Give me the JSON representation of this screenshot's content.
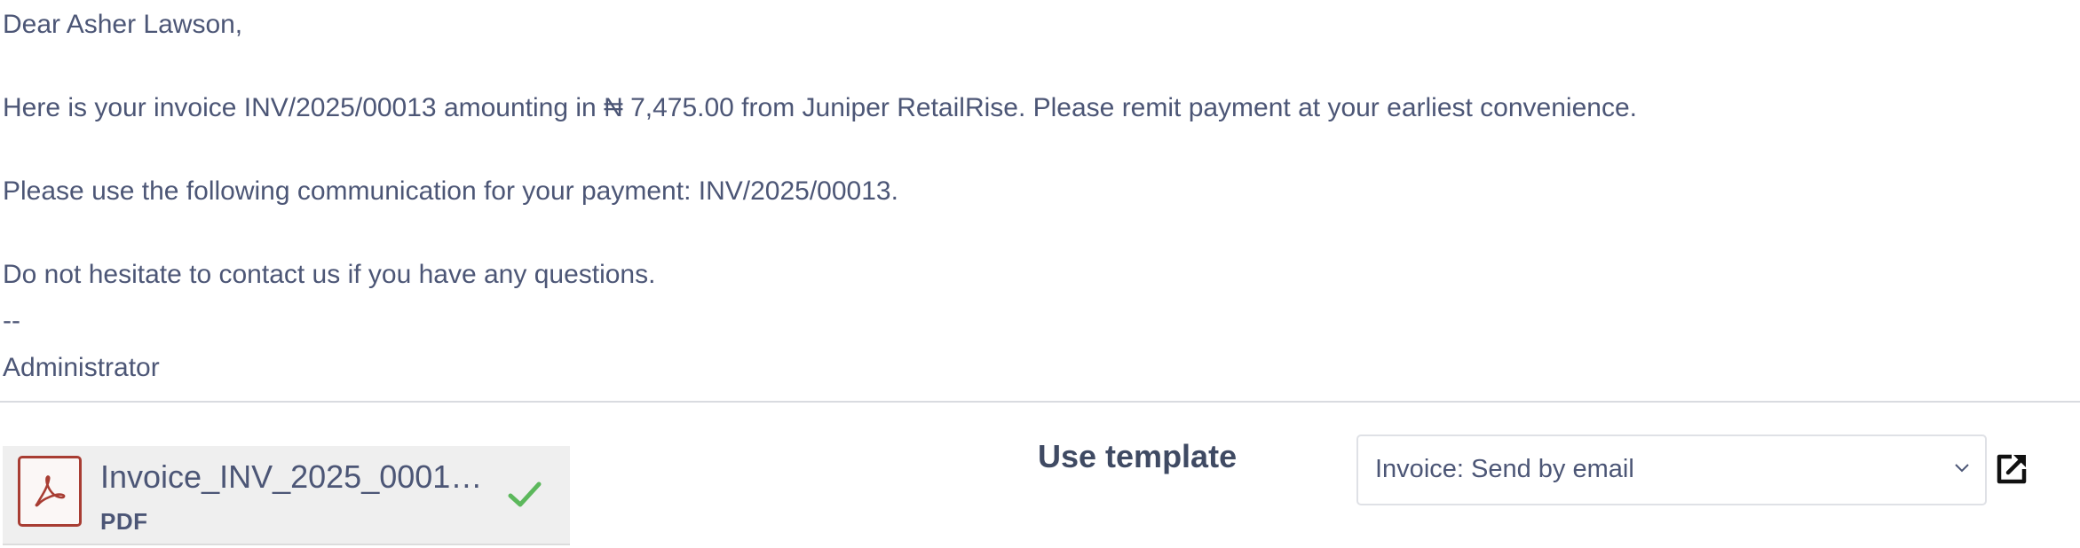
{
  "email_body": {
    "greeting": "Dear Asher Lawson,",
    "invoice_line": "Here is your invoice INV/2025/00013 amounting in ₦ 7,475.00 from Juniper RetailRise. Please remit payment at your earliest convenience.",
    "communication_line": "Please use the following communication for your payment: INV/2025/00013.",
    "contact_line": "Do not hesitate to contact us if you have any questions.",
    "signature_separator": "--",
    "signature_name": "Administrator"
  },
  "attachment": {
    "name": "Invoice_INV_2025_00013.pdf",
    "display_name": "Invoice_INV_2025_00013...",
    "type_label": "PDF",
    "icon": "pdf-icon",
    "status_icon": "check-icon",
    "status_color": "#5cb85c",
    "icon_color": "#a83d33"
  },
  "template": {
    "label": "Use template",
    "selected_value": "Invoice: Send by email",
    "dropdown_icon": "chevron-down-icon",
    "open_icon": "external-link-icon"
  }
}
